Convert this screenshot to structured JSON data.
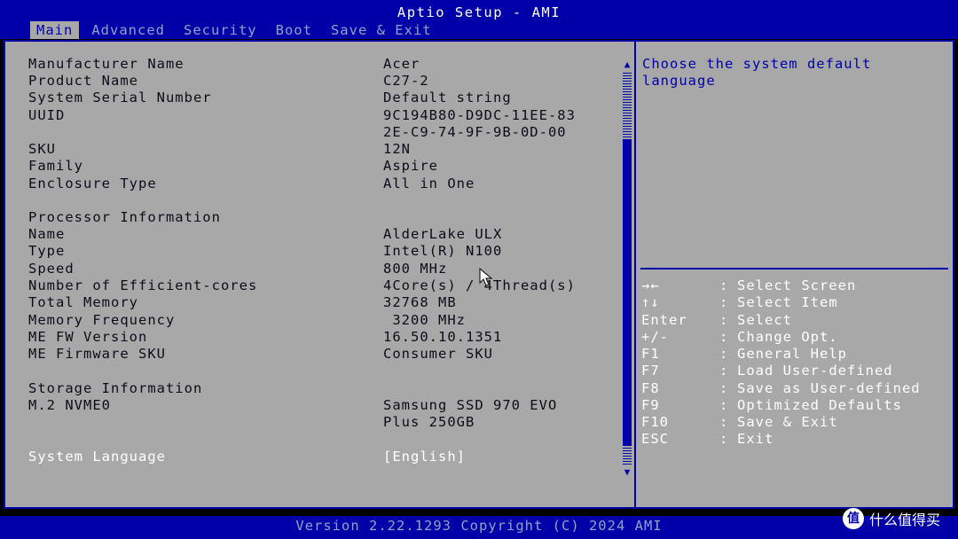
{
  "title": "Aptio Setup - AMI",
  "tabs": [
    {
      "label": "Main",
      "active": true
    },
    {
      "label": "Advanced",
      "active": false
    },
    {
      "label": "Security",
      "active": false
    },
    {
      "label": "Boot",
      "active": false
    },
    {
      "label": "Save & Exit",
      "active": false
    }
  ],
  "info": {
    "manufacturer_label": "Manufacturer Name",
    "manufacturer_value": "Acer",
    "product_label": "Product Name",
    "product_value": "C27-2",
    "serial_label": "System Serial Number",
    "serial_value": "Default string",
    "uuid_label": "UUID",
    "uuid_value_1": "9C194B80-D9DC-11EE-83",
    "uuid_value_2": "2E-C9-74-9F-9B-0D-00",
    "sku_label": "SKU",
    "sku_value": "12N",
    "family_label": "Family",
    "family_value": "Aspire",
    "enclosure_label": "Enclosure Type",
    "enclosure_value": "All in One"
  },
  "processor": {
    "heading": "Processor Information",
    "name_label": "Name",
    "name_value": "AlderLake ULX",
    "type_label": "Type",
    "type_value": "Intel(R) N100",
    "speed_label": "Speed",
    "speed_value": "800 MHz",
    "cores_label": "Number of Efficient-cores",
    "cores_value": "4Core(s) / 4Thread(s)",
    "memory_label": "Total Memory",
    "memory_value": "32768 MB",
    "memfreq_label": "Memory Frequency",
    "memfreq_value": " 3200 MHz",
    "mefw_label": "ME FW Version",
    "mefw_value": "16.50.10.1351",
    "mesku_label": "ME Firmware SKU",
    "mesku_value": "Consumer SKU"
  },
  "storage": {
    "heading": "Storage Information",
    "nvme_label": "M.2 NVME0",
    "nvme_value_1": "Samsung SSD 970 EVO",
    "nvme_value_2": "Plus 250GB"
  },
  "language": {
    "label": "System Language",
    "value": "[English]"
  },
  "help_text_1": "Choose the system default",
  "help_text_2": "language",
  "keys": [
    {
      "key": "→←",
      "desc": "Select Screen"
    },
    {
      "key": "↑↓",
      "desc": "Select Item"
    },
    {
      "key": "Enter",
      "desc": "Select"
    },
    {
      "key": "+/-",
      "desc": "Change Opt."
    },
    {
      "key": "F1",
      "desc": "General Help"
    },
    {
      "key": "F7",
      "desc": "Load User-defined"
    },
    {
      "key": "F8",
      "desc": "Save as User-defined"
    },
    {
      "key": "F9",
      "desc": "Optimized Defaults"
    },
    {
      "key": "F10",
      "desc": "Save & Exit"
    },
    {
      "key": "ESC",
      "desc": "Exit"
    }
  ],
  "key_separator": ":",
  "version": "Version 2.22.1293 Copyright (C) 2024 AMI",
  "watermark": {
    "badge": "值",
    "text": "什么值得买"
  },
  "colors": {
    "blue": "#0000a8",
    "panel": "#a8a8a8",
    "tab_inactive": "#8fa3c8"
  }
}
